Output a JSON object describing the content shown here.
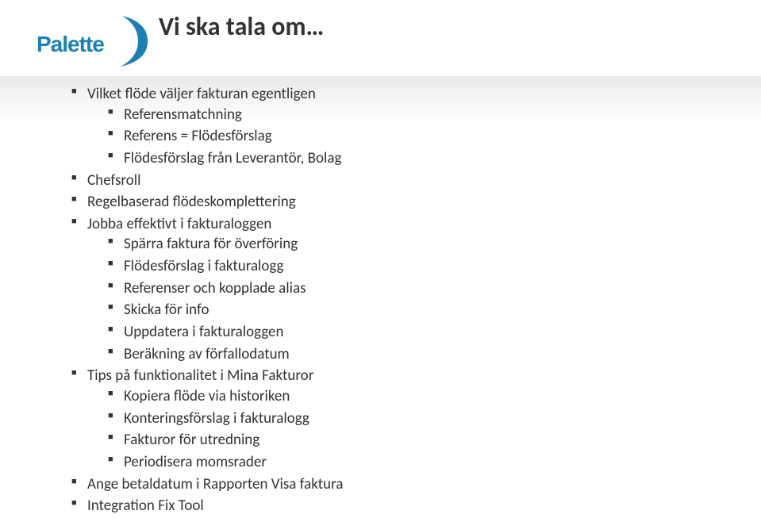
{
  "logo": {
    "brand": "Palette"
  },
  "title": "Vi ska tala om…",
  "bullets": [
    {
      "text": "Vilket flöde väljer fakturan egentligen",
      "children": [
        {
          "text": "Referensmatchning"
        },
        {
          "text": "Referens = Flödesförslag"
        },
        {
          "text": "Flödesförslag från Leverantör, Bolag"
        }
      ]
    },
    {
      "text": "Chefsroll"
    },
    {
      "text": "Regelbaserad flödeskomplettering"
    },
    {
      "text": "Jobba effektivt i fakturaloggen",
      "children": [
        {
          "text": "Spärra faktura för överföring"
        },
        {
          "text": "Flödesförslag i fakturalogg"
        },
        {
          "text": "Referenser och kopplade alias"
        },
        {
          "text": "Skicka för info"
        },
        {
          "text": "Uppdatera i fakturaloggen"
        },
        {
          "text": "Beräkning av förfallodatum"
        }
      ]
    },
    {
      "text": "Tips på funktionalitet i Mina Fakturor",
      "children": [
        {
          "text": "Kopiera flöde via historiken"
        },
        {
          "text": "Konteringsförslag i fakturalogg"
        },
        {
          "text": "Fakturor för utredning"
        },
        {
          "text": "Periodisera momsrader"
        }
      ]
    },
    {
      "text": "Ange betaldatum i Rapporten Visa faktura"
    },
    {
      "text": "Integration Fix Tool"
    }
  ]
}
